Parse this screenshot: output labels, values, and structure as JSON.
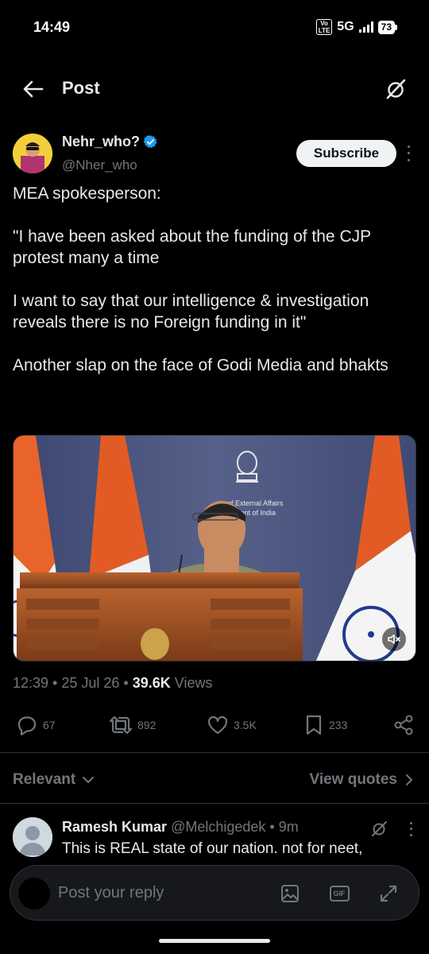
{
  "status_bar": {
    "time": "14:49",
    "volte": "Vo LTE",
    "network": "5G",
    "battery": "73"
  },
  "header": {
    "title": "Post",
    "back_icon": "arrow-left-icon",
    "grok_icon": "grok-icon"
  },
  "post": {
    "author_name": "Nehr_who?",
    "author_handle": "@Nher_who",
    "verified": true,
    "subscribe_label": "Subscribe",
    "paragraphs": [
      "MEA spokesperson:",
      "\"I have been asked about the funding of the CJP protest many a time",
      "I want to say that our intelligence & investigation reveals there is no Foreign funding in it\"",
      "Another slap on the face of Godi Media and bhakts"
    ],
    "media": {
      "type": "video",
      "backdrop_text_1": "y of External Affairs",
      "backdrop_text_2": "rnment of India",
      "mute_icon": "volume-muted-icon"
    },
    "timestamp": "12:39 • 25 Jul 26 • ",
    "views_count": "39.6K",
    "views_label": "Views",
    "actions": {
      "replies": "67",
      "reposts": "892",
      "likes": "3.5K",
      "bookmarks": "233"
    }
  },
  "replies_section": {
    "sort_label": "Relevant",
    "view_quotes_label": "View quotes",
    "first_reply": {
      "name": "Ramesh Kumar",
      "handle": "@Melchigedek",
      "time": "• 9m",
      "text": "This is REAL state of our nation. not for neet,"
    }
  },
  "composer": {
    "placeholder": "Post your reply",
    "gif_label": "GIF"
  },
  "colors": {
    "background": "#000000",
    "text_primary": "#e7e9ea",
    "text_secondary": "#71767b",
    "verified_blue": "#1d9bf0",
    "divider": "#2f3336"
  }
}
